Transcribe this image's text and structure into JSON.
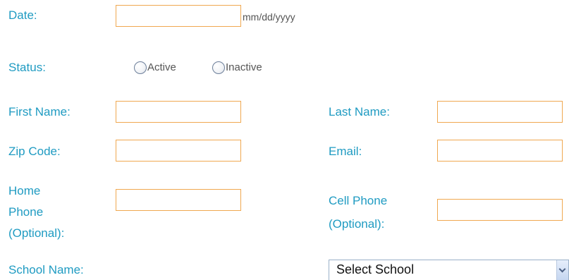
{
  "form": {
    "date": {
      "label": "Date:",
      "value": "",
      "hint": "mm/dd/yyyy"
    },
    "status": {
      "label": "Status:",
      "options": [
        "Active",
        "Inactive"
      ],
      "selected": null
    },
    "first_name": {
      "label": "First Name:",
      "value": ""
    },
    "last_name": {
      "label": "Last Name:",
      "value": ""
    },
    "zip_code": {
      "label": "Zip Code:",
      "value": ""
    },
    "email": {
      "label": "Email:",
      "value": ""
    },
    "home_phone": {
      "label_lines": [
        "Home",
        "Phone",
        "(Optional):"
      ],
      "value": ""
    },
    "cell_phone": {
      "label_lines": [
        "Cell Phone",
        "(Optional):"
      ],
      "value": ""
    },
    "school": {
      "label": "School Name:",
      "selected": "Select School"
    }
  },
  "colors": {
    "label": "#1f9bc2",
    "field_border": "#f0a850",
    "hint_text": "#555555"
  },
  "icons": {
    "radio": "radio-circle-icon",
    "dropdown": "chevron-down-icon"
  }
}
